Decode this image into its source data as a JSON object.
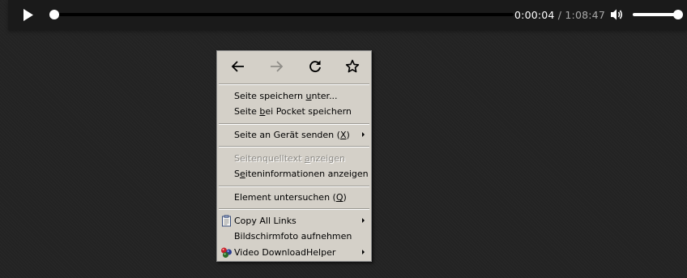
{
  "player": {
    "elapsed": "0:00:04",
    "separator": "/",
    "duration": "1:08:47",
    "progress_fraction": 0.0,
    "volume_fraction": 1.0,
    "icons": {
      "play": "play-icon",
      "volume": "volume-icon"
    }
  },
  "context_menu": {
    "nav": [
      {
        "icon": "back-arrow-icon",
        "enabled": true
      },
      {
        "icon": "forward-arrow-icon",
        "enabled": false
      },
      {
        "icon": "reload-icon",
        "enabled": true
      },
      {
        "icon": "bookmark-star-icon",
        "enabled": true
      }
    ],
    "items": {
      "save_page_as": {
        "pre": "Seite speichern ",
        "key": "u",
        "post": "nter..."
      },
      "save_to_pocket": {
        "pre": "Seite ",
        "key": "b",
        "post": "ei Pocket speichern"
      },
      "send_to_device": {
        "pre": "Seite an Gerät senden (",
        "key": "X",
        "post": ")"
      },
      "view_source": {
        "pre": "Seitenquelltext ",
        "key": "a",
        "post": "nzeigen",
        "disabled": true
      },
      "page_info": {
        "pre": "S",
        "key": "e",
        "post": "iteninformationen anzeigen"
      },
      "inspect_element": {
        "pre": "Element untersuchen (",
        "key": "Q",
        "post": ")"
      },
      "copy_all_links": {
        "label": "Copy All Links",
        "icon": "clipboard-icon"
      },
      "screenshot": {
        "label": "Bildschirmfoto aufnehmen"
      },
      "video_downloadhelper": {
        "label": "Video DownloadHelper",
        "icon": "downloadhelper-balls-icon"
      }
    }
  }
}
